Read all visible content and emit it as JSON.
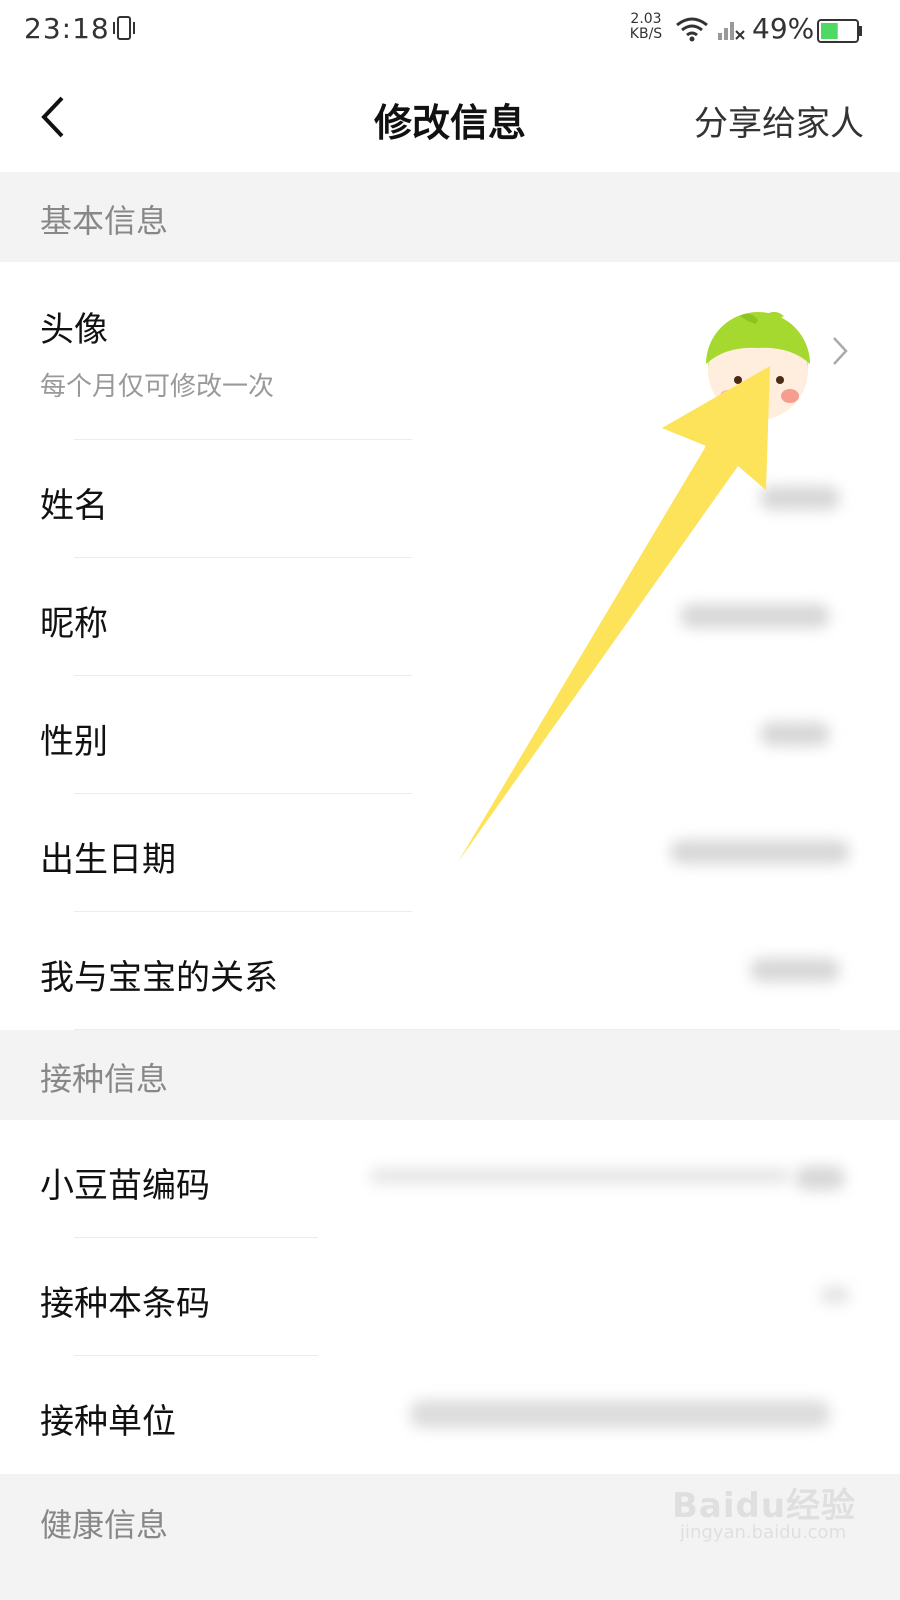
{
  "status_bar": {
    "time": "23:18",
    "net_speed_value": "2.03",
    "net_speed_unit": "KB/S",
    "battery_percent": "49%",
    "battery_level": 0.49,
    "icons": [
      "vibrate-icon",
      "wifi-icon",
      "signal-icon",
      "battery-icon"
    ]
  },
  "nav": {
    "title": "修改信息",
    "share_label": "分享给家人",
    "back_icon": "chevron-left-icon"
  },
  "sections": [
    {
      "title": "基本信息",
      "rows": [
        {
          "label": "头像",
          "sub": "每个月仅可修改一次",
          "value": "avatar-image"
        },
        {
          "label": "姓名"
        },
        {
          "label": "昵称"
        },
        {
          "label": "性别"
        },
        {
          "label": "出生日期"
        },
        {
          "label": "我与宝宝的关系"
        }
      ]
    },
    {
      "title": "接种信息",
      "rows": [
        {
          "label": "小豆苗编码"
        },
        {
          "label": "接种本条码"
        },
        {
          "label": "接种单位"
        }
      ]
    },
    {
      "title": "健康信息",
      "rows": []
    }
  ],
  "watermark": {
    "brand": "Baidu经验",
    "url": "jingyan.baidu.com"
  },
  "colors": {
    "section_bg": "#f3f3f3",
    "arrow": "#fde35a",
    "avatar_green": "#a6d92f"
  }
}
